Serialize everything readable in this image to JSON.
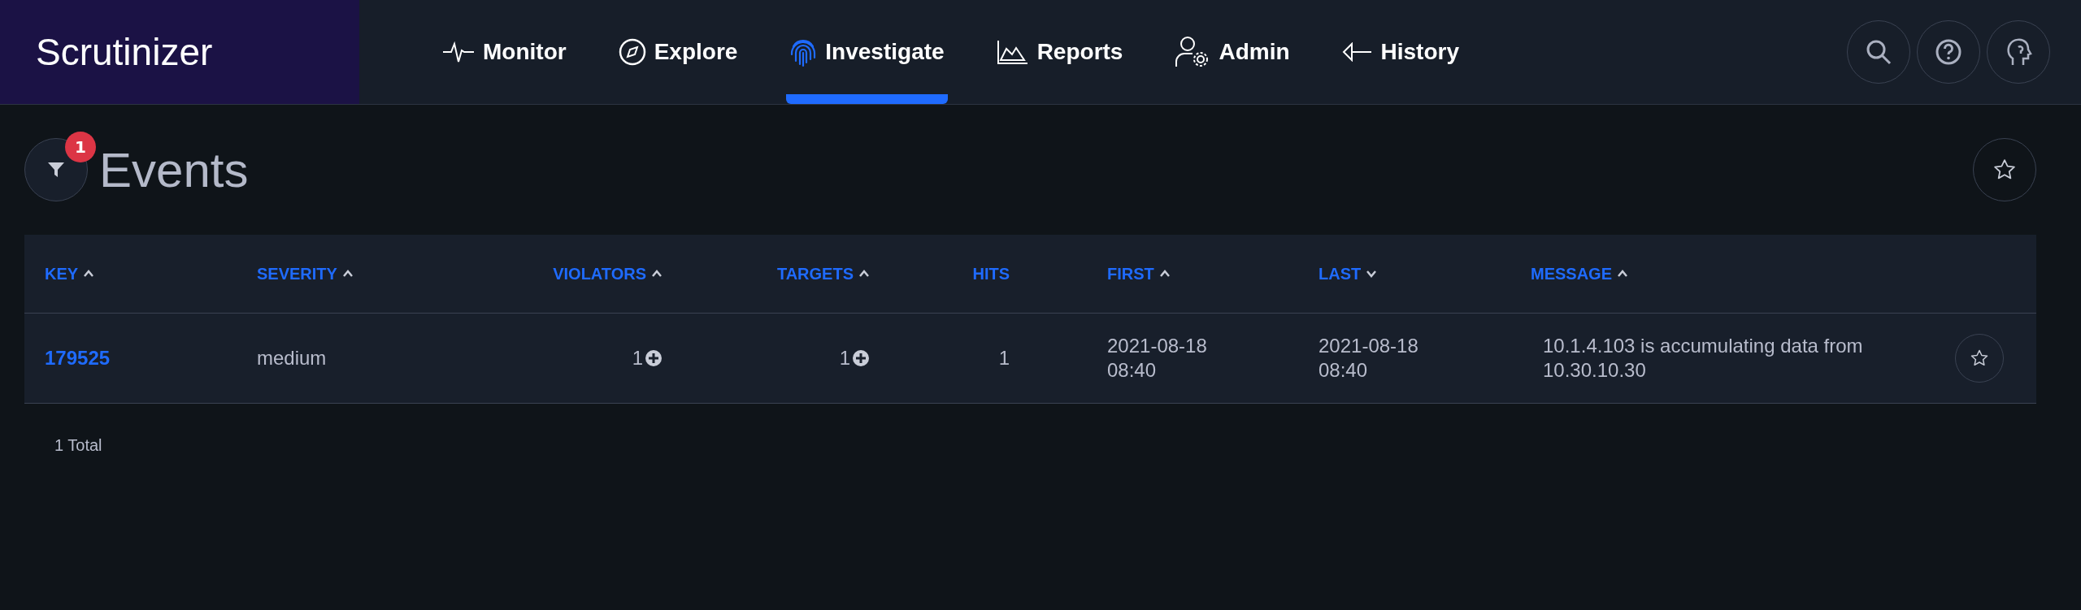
{
  "brand": "Scrutinizer",
  "nav": [
    {
      "label": "Monitor",
      "selected": false
    },
    {
      "label": "Explore",
      "selected": false
    },
    {
      "label": "Investigate",
      "selected": true
    },
    {
      "label": "Reports",
      "selected": false
    },
    {
      "label": "Admin",
      "selected": false
    },
    {
      "label": "History",
      "selected": false
    }
  ],
  "page": {
    "title": "Events",
    "filter_count": "1"
  },
  "table": {
    "columns": [
      {
        "label": "KEY",
        "sortable": true,
        "descending": false
      },
      {
        "label": "SEVERITY",
        "sortable": true,
        "descending": false
      },
      {
        "label": "VIOLATORS",
        "sortable": true,
        "descending": false
      },
      {
        "label": "TARGETS",
        "sortable": true,
        "descending": false
      },
      {
        "label": "HITS",
        "sortable": false
      },
      {
        "label": "FIRST",
        "sortable": true,
        "descending": false
      },
      {
        "label": "LAST",
        "sortable": true,
        "descending": true
      },
      {
        "label": "MESSAGE",
        "sortable": true,
        "descending": false
      }
    ],
    "rows": [
      {
        "key": "179525",
        "severity": "medium",
        "violators": "1",
        "targets": "1",
        "hits": "1",
        "first": [
          "2021-08-18",
          "08:40"
        ],
        "last": [
          "2021-08-18",
          "08:40"
        ],
        "message": "10.1.4.103 is accumulating data from 10.30.10.30"
      }
    ]
  },
  "total": "1 Total"
}
